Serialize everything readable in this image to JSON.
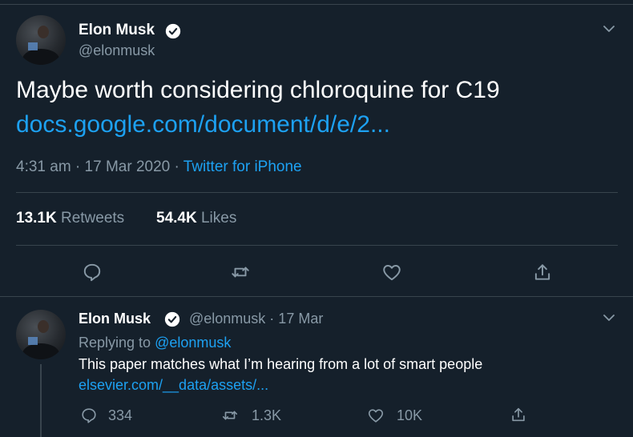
{
  "main_tweet": {
    "name": "Elon Musk",
    "handle": "@elonmusk",
    "text": "Maybe worth considering chloroquine for C19",
    "link": "docs.google.com/document/d/e/2...",
    "time": "4:31 am · 17 Mar 2020 · ",
    "source": "Twitter for iPhone",
    "retweets_count": "13.1K",
    "retweets_label": "Retweets",
    "likes_count": "54.4K",
    "likes_label": "Likes"
  },
  "reply_tweet": {
    "name": "Elon Musk",
    "handle_date": "@elonmusk · 17 Mar",
    "replying_prefix": "Replying to ",
    "replying_handle": "@elonmusk",
    "text": "This paper matches what I’m hearing from a lot of smart people",
    "link": "elsevier.com/__data/assets/...",
    "reply_count": "334",
    "retweet_count": "1.3K",
    "like_count": "10K"
  },
  "colors": {
    "background": "#15202b",
    "accent": "#1da1f2",
    "muted": "#8899a6",
    "divider": "#38444d"
  }
}
